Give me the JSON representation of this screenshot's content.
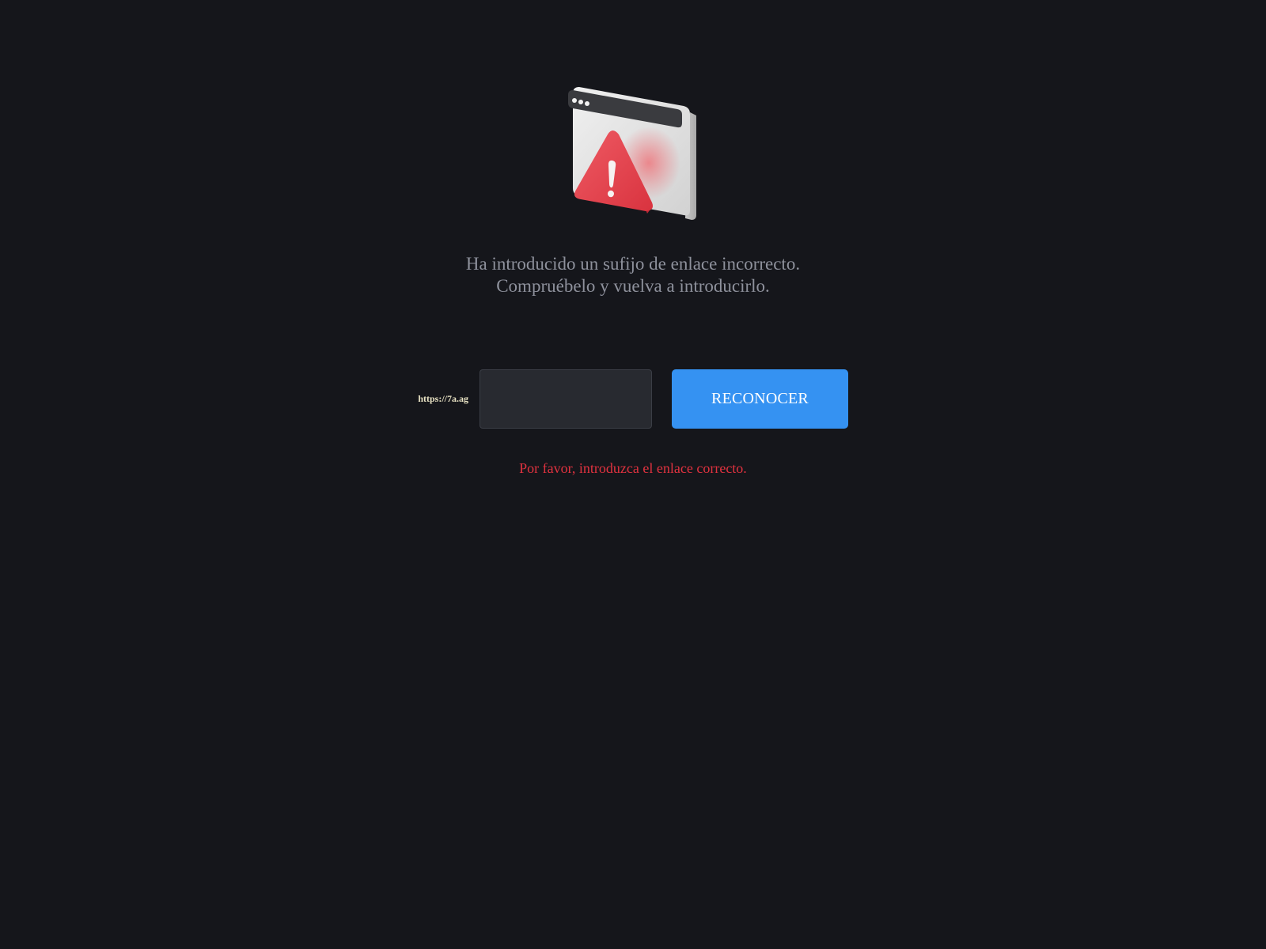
{
  "illustration": {
    "icon": "browser-window-warning-icon",
    "colors": {
      "window": "#e6e6e6",
      "titlebar": "#3a3b3f",
      "warning": "#e5434e"
    }
  },
  "message": {
    "line1": "Ha introducido un sufijo de enlace incorrecto.",
    "line2": "Compruébelo y vuelva a introducirlo."
  },
  "form": {
    "url_prefix": "https://7a.ag",
    "suffix_value": "",
    "suffix_placeholder": "",
    "button_label": "RECONOCER"
  },
  "error": {
    "text": "Por favor, introduzca el enlace correcto."
  },
  "colors": {
    "background": "#15161b",
    "accent": "#3592f2",
    "error": "#e0323f",
    "message": "#8e919c"
  }
}
